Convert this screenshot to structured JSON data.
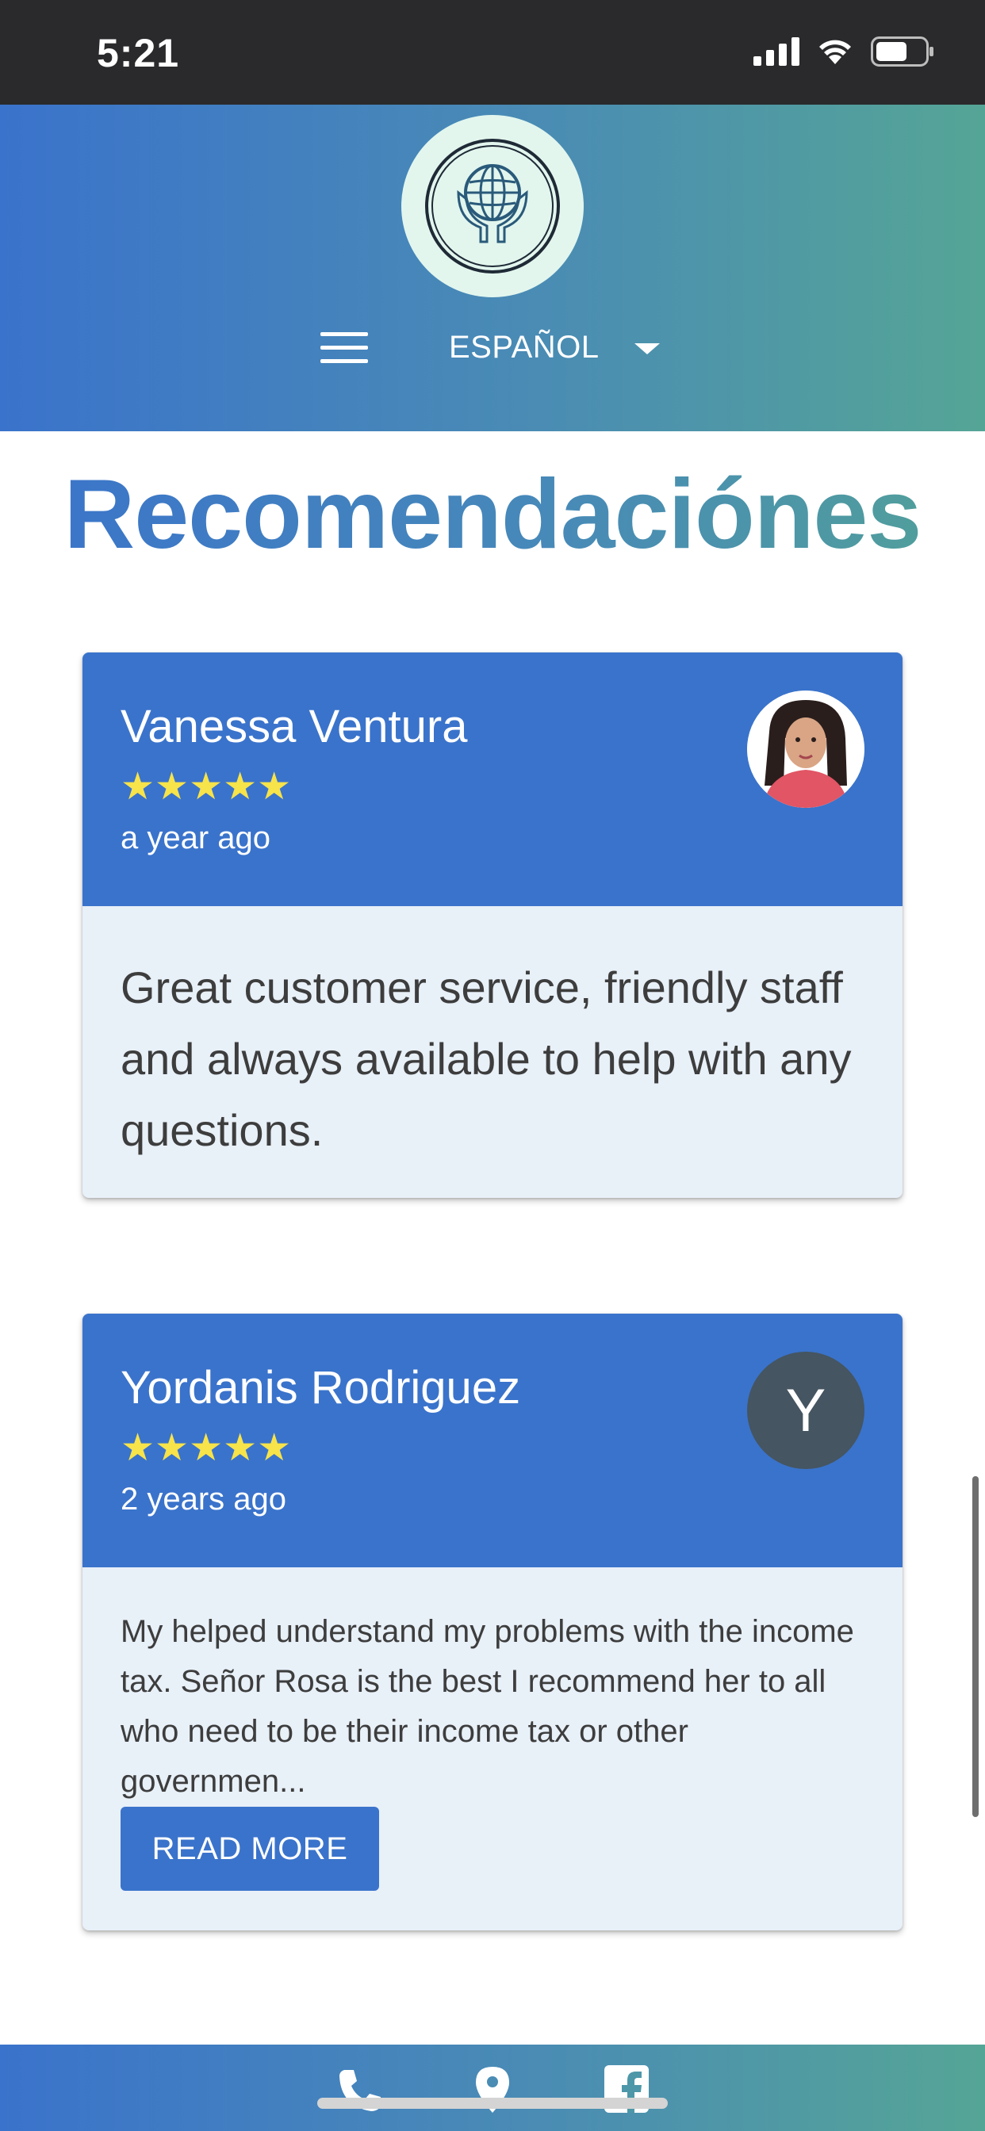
{
  "status_bar": {
    "time": "5:21",
    "icons": [
      "signal-icon",
      "wifi-icon",
      "battery-icon"
    ]
  },
  "header": {
    "logo": "globe-hands-logo-icon",
    "menu_icon": "hamburger-menu-icon",
    "language": "ESPAÑOL",
    "language_icon": "caret-down-icon"
  },
  "page": {
    "title": "Recomendaciónes"
  },
  "reviews": [
    {
      "name": "Vanessa Ventura",
      "rating": 5,
      "stars": "★★★★★",
      "date": "a year ago",
      "avatar": "profile-photo",
      "text": "Great customer service, friendly staff and always available to help with any questions."
    },
    {
      "name": "Yordanis Rodriguez",
      "rating": 5,
      "stars": "★★★★★",
      "date": "2 years ago",
      "avatar_letter": "Y",
      "text": "My helped understand my problems with the income tax. Señor Rosa is the best I recommend her to all who need to be their income tax or other governmen...",
      "read_more_label": "READ MORE"
    }
  ],
  "bottom_bar": {
    "icons": [
      "phone-icon",
      "location-pin-icon",
      "facebook-icon"
    ]
  },
  "colors": {
    "primary_blue": "#3a73cb",
    "gradient_teal": "#55a596",
    "card_body": "#e8f0f8",
    "star_yellow": "#f7e34a",
    "avatar_gray": "#455561",
    "status_bar": "#2a2a2c"
  }
}
